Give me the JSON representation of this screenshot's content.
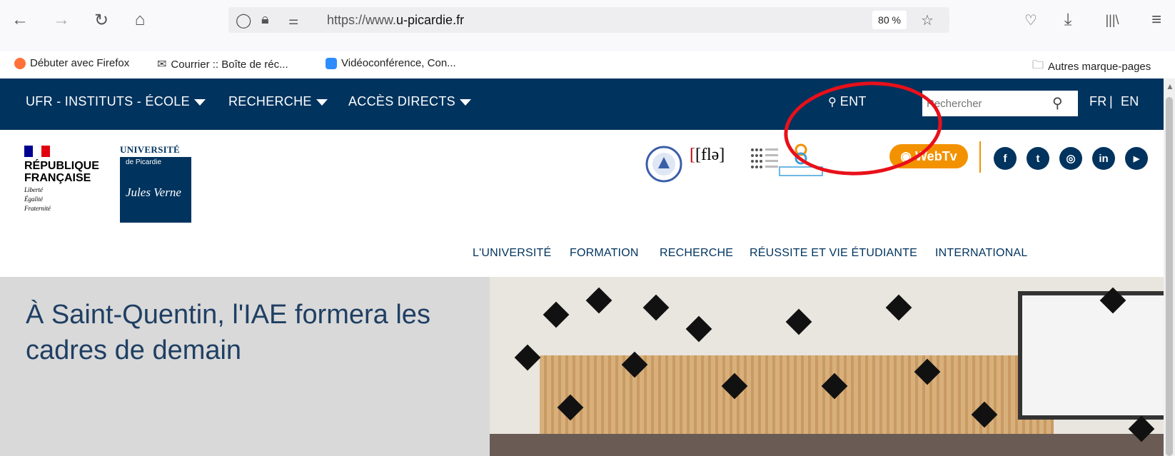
{
  "browser": {
    "url_prefix": "https://www.",
    "url_domain": "u-picardie.fr",
    "zoom": "80 %",
    "bookmarks": [
      "Débuter avec Firefox",
      "Courrier :: Boîte de réc...",
      "Vidéoconférence, Con..."
    ],
    "other_bookmarks": "Autres marque-pages"
  },
  "topnav": {
    "items": [
      "UFR - INSTITUTS - ÉCOLE",
      "RECHERCHE",
      "ACCÈS DIRECTS"
    ],
    "ent": "ENT",
    "search_placeholder": "Rechercher",
    "lang_fr": "FR",
    "lang_sep": "|",
    "lang_en": "EN"
  },
  "logos": {
    "rf_title_1": "RÉPUBLIQUE",
    "rf_title_2": "FRANÇAISE",
    "rf_motto_1": "Liberté",
    "rf_motto_2": "Égalité",
    "rf_motto_3": "Fraternité",
    "univ_top": "UNIVERSITÉ",
    "univ_sub": "de Picardie",
    "univ_sig": "Jules Verne",
    "fle": "[flə]",
    "webtv": "WebTv"
  },
  "mainnav": [
    "L'UNIVERSITÉ",
    "FORMATION",
    "RECHERCHE",
    "RÉUSSITE ET VIE ÉTUDIANTE",
    "INTERNATIONAL"
  ],
  "hero": {
    "title": "À Saint-Quentin, l'IAE formera les cadres de demain"
  },
  "colors": {
    "navy": "#00335e",
    "orange": "#f39200",
    "annotation": "#e8101a"
  }
}
